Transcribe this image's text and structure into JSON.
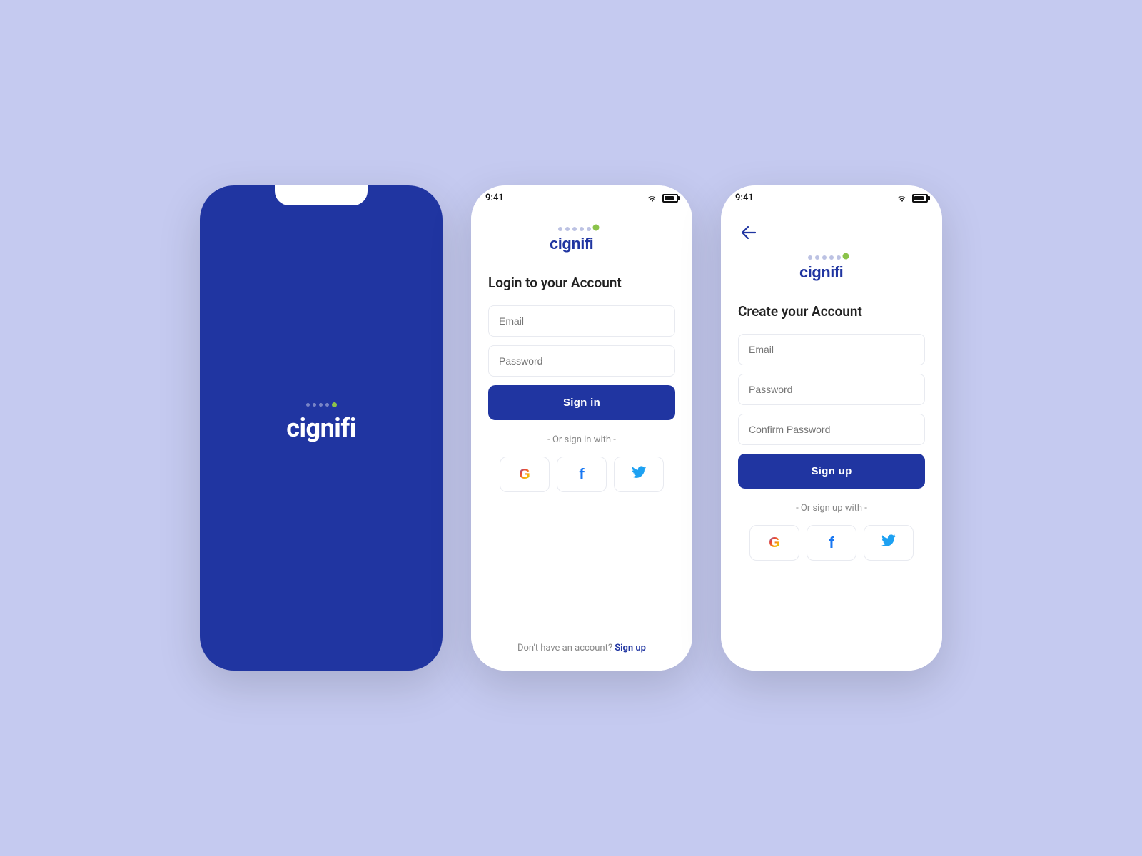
{
  "background": "#c5caf0",
  "brand": {
    "name": "cignifi",
    "color": "#2035a1"
  },
  "splash": {
    "logo": "cignifi"
  },
  "login": {
    "status_time": "9:41",
    "title": "Login to your Account",
    "email_placeholder": "Email",
    "password_placeholder": "Password",
    "sign_in_label": "Sign in",
    "or_divider": "- Or sign in with -",
    "bottom_text": "Don't have an account?",
    "sign_up_link": "Sign up"
  },
  "register": {
    "status_time": "9:41",
    "title": "Create your Account",
    "email_placeholder": "Email",
    "password_placeholder": "Password",
    "confirm_password_placeholder": "Confirm Password",
    "sign_up_label": "Sign up",
    "or_divider": "- Or sign up with -"
  }
}
